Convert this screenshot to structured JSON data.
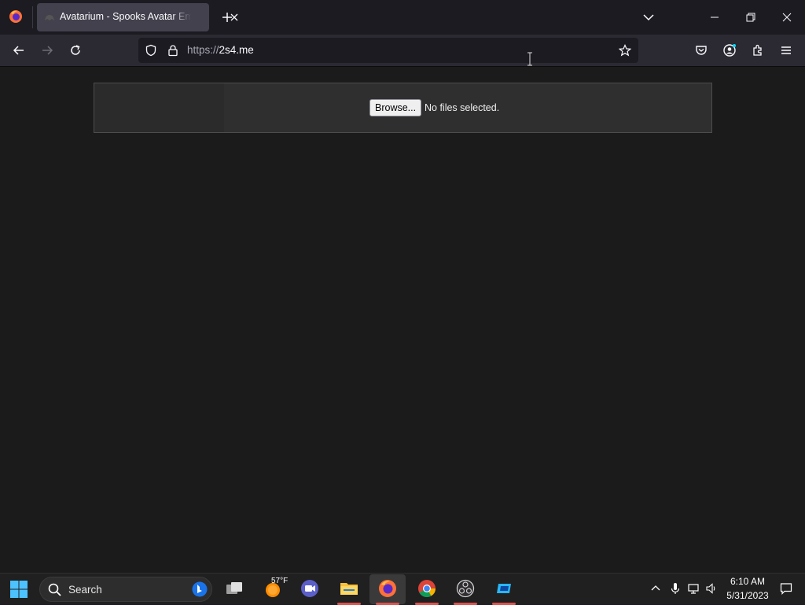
{
  "tab": {
    "title": "Avatarium - Spooks Avatar Emp"
  },
  "nav": {
    "url_scheme": "https://",
    "url_host": "2s4.me"
  },
  "page": {
    "browse_label": "Browse...",
    "file_status": "No files selected."
  },
  "taskbar": {
    "search_placeholder": "Search",
    "weather_temp": "57°F",
    "time": "6:10 AM",
    "date": "5/31/2023"
  },
  "icons": {
    "browser": "firefox-icon",
    "tab_favicon": "ghost-icon",
    "apps": [
      "task-view-icon",
      "weather-icon",
      "teams-icon",
      "file-explorer-icon",
      "firefox-icon",
      "chrome-icon",
      "obs-icon",
      "app-icon"
    ]
  },
  "colors": {
    "chrome_dark": "#1c1b22",
    "toolbar": "#2b2a33",
    "active_tab": "#42414d",
    "page_bg": "#1c1b1b",
    "taskbar": "#202020",
    "taskbar_indicator": "#d9534f"
  }
}
